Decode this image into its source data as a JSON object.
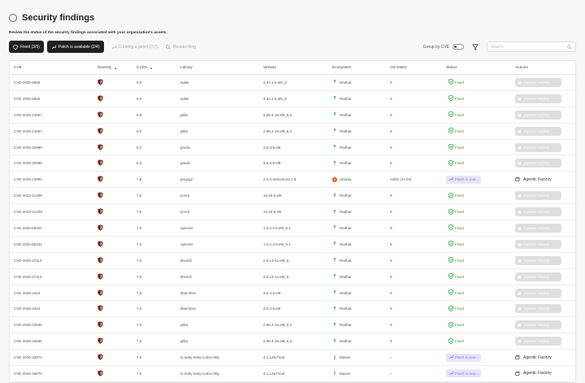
{
  "page": {
    "title": "Security findings",
    "subtitle": "Review the status of the security findings associated with your organization's assets."
  },
  "toolbar": {
    "fixed_label": "Fixed (3/5)",
    "patch_available_label": "Patch is available (2/4)",
    "creating_patch_label": "Creating a patch (7/7)",
    "researching_label": "Researching",
    "group_by_label": "Group by CVE",
    "search_placeholder": "Search"
  },
  "columns": [
    "CVE",
    "Severity",
    "CVSS",
    "Library",
    "Version",
    "Ecosystem",
    "OS Distro",
    "Status",
    "Actions"
  ],
  "actions": {
    "agentic_factory": "Agentic Factory"
  },
  "rows": [
    {
      "cve": "CVE-2025-6965",
      "cvss": "9.8",
      "library": "sqlite",
      "version": "3.34.1-6.el9_6",
      "ecosystem": "Redhat",
      "distro": "9",
      "status": "Fixed",
      "action": "Agentic Factory",
      "action_enabled": false
    },
    {
      "cve": "CVE-2025-6965",
      "cvss": "9.8",
      "library": "sqlite",
      "version": "3.34.1-6.el9_6",
      "ecosystem": "Redhat",
      "distro": "8",
      "status": "Fixed",
      "action": "Agentic Factory",
      "action_enabled": false
    },
    {
      "cve": "CVE-2025-14087",
      "cvss": "9.8",
      "library": "glib2",
      "version": "2.68.4-16.el9_6.2",
      "ecosystem": "Redhat",
      "distro": "9",
      "status": "Fixed",
      "action": "Agentic Factory",
      "action_enabled": false
    },
    {
      "cve": "CVE-2025-14087",
      "cvss": "9.8",
      "library": "glib2",
      "version": "2.68.4-16.el9_6.2",
      "ecosystem": "Redhat",
      "distro": "8",
      "status": "Fixed",
      "action": "Agentic Factory",
      "action_enabled": false
    },
    {
      "cve": "CVE-2025-32990",
      "cvss": "8.2",
      "library": "gnutls",
      "version": "3.8.3-9.el9",
      "ecosystem": "Redhat",
      "distro": "9",
      "status": "Fixed",
      "action": "Agentic Factory",
      "action_enabled": false
    },
    {
      "cve": "CVE-2025-32988",
      "cvss": "8.2",
      "library": "gnutls",
      "version": "3.8.3-9.el9",
      "ecosystem": "Redhat",
      "distro": "8",
      "status": "Fixed",
      "action": "Agentic Factory",
      "action_enabled": false
    },
    {
      "cve": "CVE-2026-24882",
      "cvss": "7.8",
      "library": "gnupg2",
      "version": "2.4.4-3ubuntu10.7.6",
      "ecosystem": "Ubuntu",
      "distro": "noble (24.04)",
      "status": "Patch is avai...",
      "action": "Agentic Factory",
      "action_enabled": true
    },
    {
      "cve": "CVE-2022-41409",
      "cvss": "7.5",
      "library": "pcre2",
      "version": "10.40-6.el9",
      "ecosystem": "Redhat",
      "distro": "9",
      "status": "Fixed",
      "action": "Agentic Factory",
      "action_enabled": false
    },
    {
      "cve": "CVE-2022-41409",
      "cvss": "7.5",
      "library": "pcre2",
      "version": "10.40-6.el9",
      "ecosystem": "Redhat",
      "distro": "8",
      "status": "Fixed",
      "action": "Agentic Factory",
      "action_enabled": false
    },
    {
      "cve": "CVE-2025-68431",
      "cvss": "7.5",
      "library": "openssl",
      "version": "1:3.2.2-6.el9_5.1",
      "ecosystem": "Redhat",
      "distro": "9",
      "status": "Fixed",
      "action": "Agentic Factory",
      "action_enabled": false
    },
    {
      "cve": "CVE-2025-68431",
      "cvss": "7.5",
      "library": "openssl",
      "version": "1:3.2.2-6.el9_5.1",
      "ecosystem": "Redhat",
      "distro": "8",
      "status": "Fixed",
      "action": "Agentic Factory",
      "action_enabled": false
    },
    {
      "cve": "CVE-2025-27113",
      "cvss": "7.5",
      "library": "libxml2",
      "version": "2.9.13-12.el9_6",
      "ecosystem": "Redhat",
      "distro": "9",
      "status": "Fixed",
      "action": "Agentic Factory",
      "action_enabled": false
    },
    {
      "cve": "CVE-2025-27113",
      "cvss": "7.5",
      "library": "libxml2",
      "version": "2.9.13-12.el9_6",
      "ecosystem": "Redhat",
      "distro": "8",
      "status": "Fixed",
      "action": "Agentic Factory",
      "action_enabled": false
    },
    {
      "cve": "CVE-2026-4424",
      "cvss": "7.5",
      "library": "libarchive",
      "version": "3.5.3-6.el9",
      "ecosystem": "Redhat",
      "distro": "9",
      "status": "Fixed",
      "action": "Agentic Factory",
      "action_enabled": false
    },
    {
      "cve": "CVE-2026-4424",
      "cvss": "7.5",
      "library": "libarchive",
      "version": "3.5.3-6.el9",
      "ecosystem": "Redhat",
      "distro": "8",
      "status": "Fixed",
      "action": "Agentic Factory",
      "action_enabled": false
    },
    {
      "cve": "CVE-2025-33636",
      "cvss": "7.5",
      "library": "glib2",
      "version": "2.68.4-16.el9_6.2",
      "ecosystem": "Redhat",
      "distro": "9",
      "status": "Fixed",
      "action": "Agentic Factory",
      "action_enabled": false
    },
    {
      "cve": "CVE-2025-33636",
      "cvss": "7.5",
      "library": "glib2",
      "version": "2.68.4-16.el9_6.2",
      "ecosystem": "Redhat",
      "distro": "8",
      "status": "Fixed",
      "action": "Agentic Factory",
      "action_enabled": false
    },
    {
      "cve": "CVE-2026-33870",
      "cvss": "7.5",
      "library": "io.netty:netty-codec-http",
      "version": "4.1.128.Final",
      "ecosystem": "Maven",
      "distro": "–",
      "status": "Patch is avai...",
      "action": "Agentic Factory",
      "action_enabled": true
    },
    {
      "cve": "CVE-2026-33870",
      "cvss": "7.5",
      "library": "io.netty:netty-codec-http",
      "version": "4.1.128.Final",
      "ecosystem": "Maven",
      "distro": "–",
      "status": "Patch is avai...",
      "action": "Agentic Factory",
      "action_enabled": true
    }
  ]
}
